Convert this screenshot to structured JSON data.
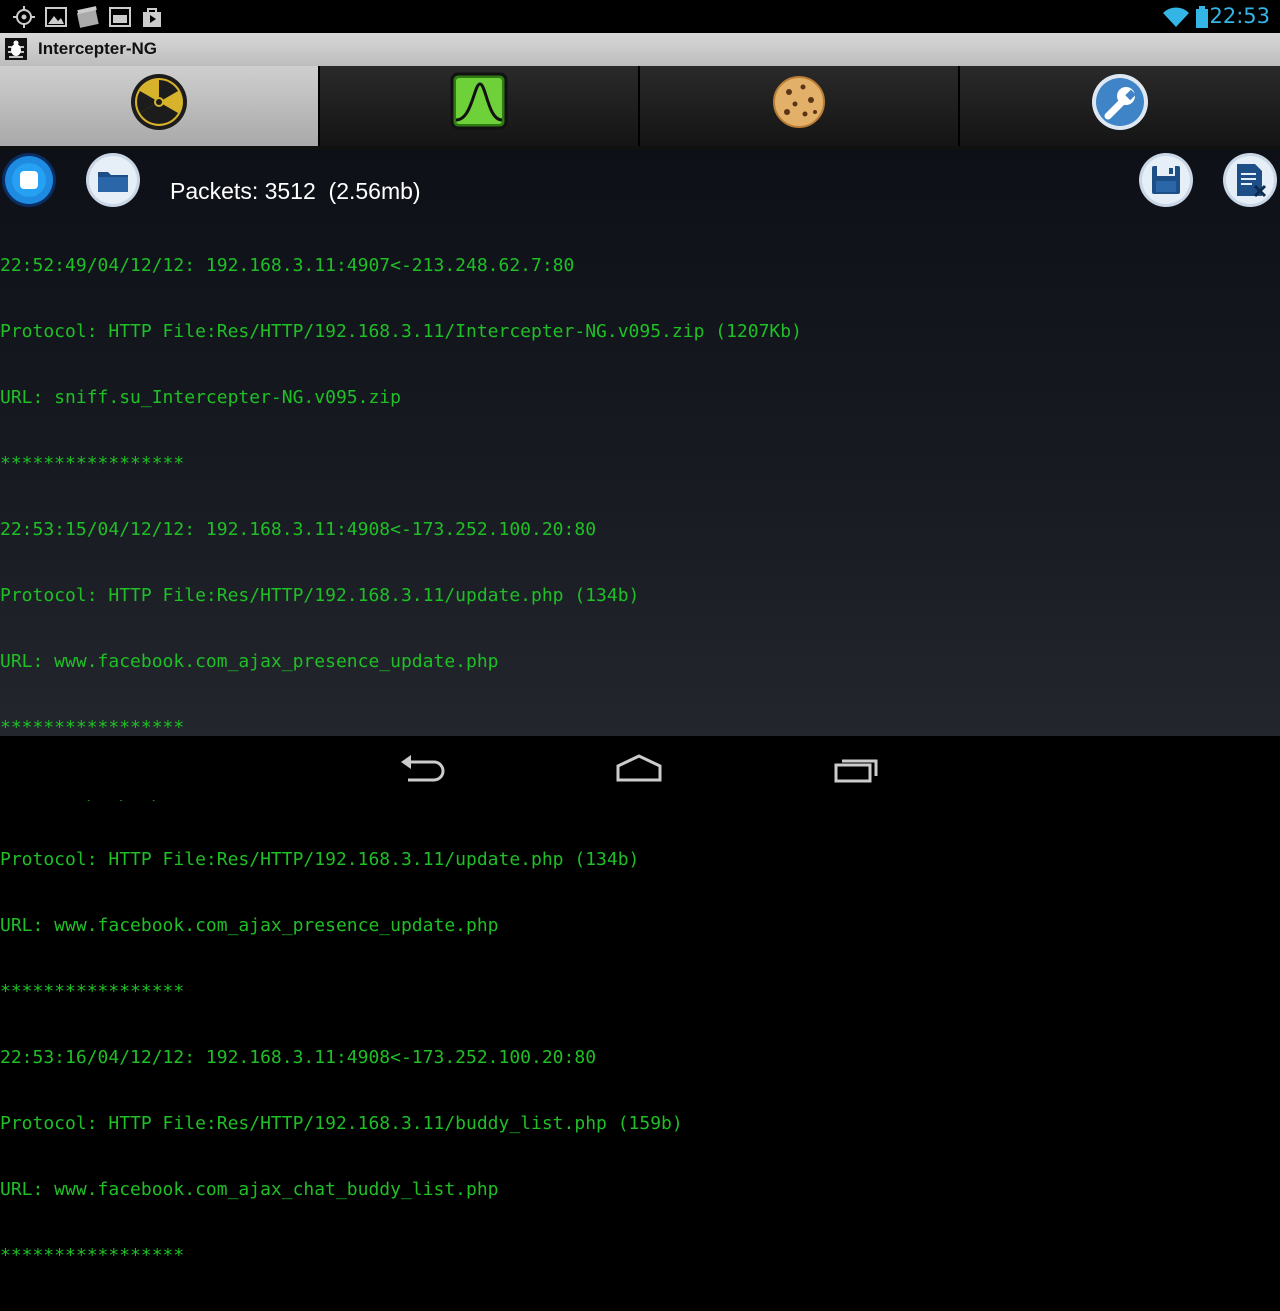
{
  "status_bar": {
    "time": "22:53",
    "left_icons": [
      "gps-icon",
      "gallery-icon",
      "clapper-icon",
      "image-icon",
      "play-store-icon"
    ],
    "right_icons": [
      "wifi-icon",
      "battery-icon"
    ],
    "accent": "#33b5e5"
  },
  "app": {
    "title": "Intercepter-NG"
  },
  "tabs": [
    {
      "icon": "radiation-icon",
      "active": true
    },
    {
      "icon": "wireshark-icon",
      "active": false
    },
    {
      "icon": "cookie-icon",
      "active": false
    },
    {
      "icon": "wrench-icon",
      "active": false
    }
  ],
  "toolbar": {
    "packets_text": "Packets: 3512  (2.56mb)",
    "buttons": [
      "stop-button",
      "open-folder-button",
      "save-button",
      "clear-log-button"
    ]
  },
  "log": [
    "22:52:49/04/12/12: 192.168.3.11:4907<-213.248.62.7:80",
    "Protocol: HTTP File:Res/HTTP/192.168.3.11/Intercepter-NG.v095.zip (1207Kb)",
    "URL: sniff.su_Intercepter-NG.v095.zip",
    "*****************",
    "22:53:15/04/12/12: 192.168.3.11:4908<-173.252.100.20:80",
    "Protocol: HTTP File:Res/HTTP/192.168.3.11/update.php (134b)",
    "URL: www.facebook.com_ajax_presence_update.php",
    "*****************",
    "22:53:15/04/12/12: 192.168.3.11:4908<-173.252.100.20:80",
    "Protocol: HTTP File:Res/HTTP/192.168.3.11/update.php (134b)",
    "URL: www.facebook.com_ajax_presence_update.php",
    "*****************",
    "22:53:16/04/12/12: 192.168.3.11:4908<-173.252.100.20:80",
    "Protocol: HTTP File:Res/HTTP/192.168.3.11/buddy_list.php (159b)",
    "URL: www.facebook.com_ajax_chat_buddy_list.php",
    "*****************"
  ],
  "log_color": "#1fbf26",
  "nav_bar": {
    "buttons": [
      "back-icon",
      "home-icon",
      "recent-apps-icon"
    ]
  }
}
